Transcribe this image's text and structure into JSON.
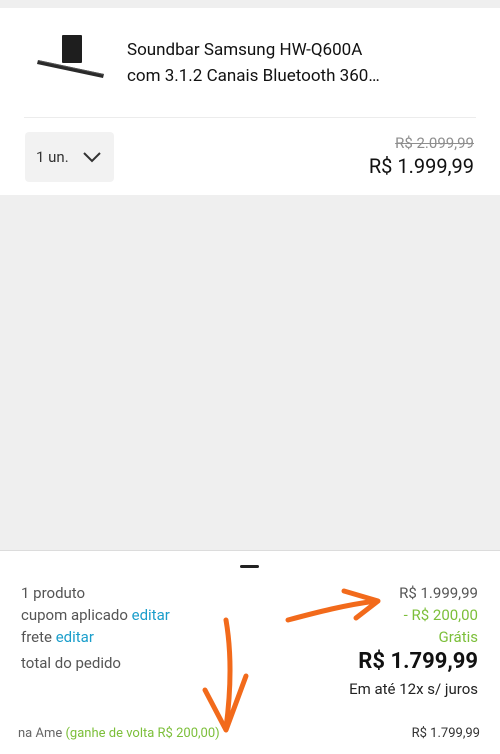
{
  "product": {
    "title": "Soundbar Samsung HW-Q600A\ncom 3.1.2 Canais Bluetooth 360…",
    "quantity": "1 un.",
    "old_price": "R$ 2.099,99",
    "price": "R$ 1.999,99"
  },
  "summary": {
    "items_label": "1 produto",
    "items_value": "R$ 1.999,99",
    "coupon_label": "cupom aplicado",
    "coupon_edit": "editar",
    "coupon_value": "- R$ 200,00",
    "shipping_label": "frete",
    "shipping_edit": "editar",
    "shipping_value": "Grátis",
    "total_label": "total do pedido",
    "total_value": "R$ 1.799,99",
    "installments": "Em até 12x s/ juros",
    "ame_label": "na Ame",
    "ame_cashback": "(ganhe de volta R$ 200,00)",
    "ame_value": "R$ 1.799,99"
  },
  "colors": {
    "link": "#1a9ecb",
    "discount_green": "#7cbf3a",
    "annotation_orange": "#f26a1b"
  }
}
